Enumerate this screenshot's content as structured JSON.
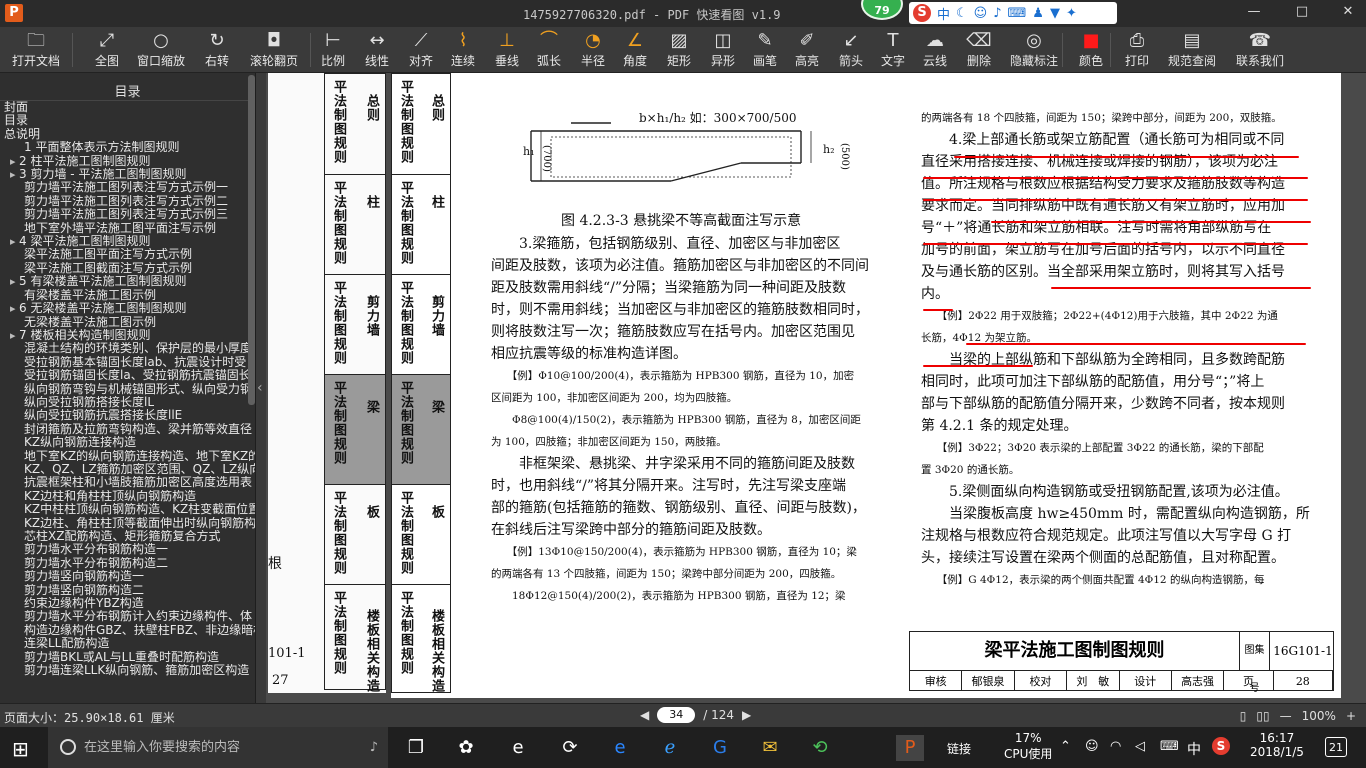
{
  "window": {
    "title": "1475927706320.pdf - PDF 快速看图 v1.9",
    "logo": "P",
    "notif_badge": "79",
    "ime_icons": [
      "sogou-s-icon",
      "中",
      "moon-icon",
      "smile-icon",
      "mic-icon",
      "keyboard-icon",
      "person-icon",
      "shirt-icon",
      "wrench-icon"
    ],
    "controls": [
      "—",
      "□",
      "✕"
    ]
  },
  "toolbar": {
    "items": [
      {
        "label": "打开文档",
        "icon": "folder-icon",
        "glyph": "🗀"
      },
      {
        "label": "全图",
        "icon": "fit-icon",
        "glyph": "⤢"
      },
      {
        "label": "窗口缩放",
        "icon": "zoom-icon",
        "glyph": "○"
      },
      {
        "label": "右转",
        "icon": "rotate-icon",
        "glyph": "↻"
      },
      {
        "label": "滚轮翻页",
        "icon": "mouse-icon",
        "glyph": "◘"
      },
      {
        "label": "比例",
        "icon": "scale-icon",
        "glyph": "⊢"
      },
      {
        "label": "线性",
        "icon": "linear-icon",
        "glyph": "↔"
      },
      {
        "label": "对齐",
        "icon": "align-icon",
        "glyph": "⟋"
      },
      {
        "label": "连续",
        "icon": "continuous-icon",
        "glyph": "⌇"
      },
      {
        "label": "垂线",
        "icon": "perpendicular-icon",
        "glyph": "⊥"
      },
      {
        "label": "弧长",
        "icon": "arc-icon",
        "glyph": "⌒"
      },
      {
        "label": "半径",
        "icon": "radius-icon",
        "glyph": "◔"
      },
      {
        "label": "角度",
        "icon": "angle-icon",
        "glyph": "∠"
      },
      {
        "label": "矩形",
        "icon": "rect-icon",
        "glyph": "▨"
      },
      {
        "label": "异形",
        "icon": "shape-icon",
        "glyph": "◫"
      },
      {
        "label": "画笔",
        "icon": "pen-icon",
        "glyph": "✎"
      },
      {
        "label": "高亮",
        "icon": "highlight-icon",
        "glyph": "✐"
      },
      {
        "label": "箭头",
        "icon": "arrow-icon",
        "glyph": "↙"
      },
      {
        "label": "文字",
        "icon": "text-icon",
        "glyph": "T"
      },
      {
        "label": "云线",
        "icon": "cloud-icon",
        "glyph": "☁"
      },
      {
        "label": "删除",
        "icon": "eraser-icon",
        "glyph": "⌫"
      },
      {
        "label": "隐藏标注",
        "icon": "eye-off-icon",
        "glyph": "◎"
      },
      {
        "label": "颜色",
        "icon": "color-icon",
        "glyph": "■"
      },
      {
        "label": "打印",
        "icon": "print-icon",
        "glyph": "⎙"
      },
      {
        "label": "规范查阅",
        "icon": "book-icon",
        "glyph": "▤"
      },
      {
        "label": "联系我们",
        "icon": "contact-icon",
        "glyph": "☎"
      }
    ]
  },
  "sidebar": {
    "header": "目录",
    "items": [
      {
        "t": "封面",
        "lvl": "l0"
      },
      {
        "t": "目录",
        "lvl": "l0"
      },
      {
        "t": "总说明",
        "lvl": "l0"
      },
      {
        "t": "1  平面整体表示方法制图规则",
        "lvl": "l1"
      },
      {
        "t": "2  柱平法施工图制图规则",
        "lvl": "exp"
      },
      {
        "t": "3  剪力墙 - 平法施工图制图规则",
        "lvl": "exp"
      },
      {
        "t": "剪力墙平法施工图列表注写方式示例一",
        "lvl": "l2"
      },
      {
        "t": "剪力墙平法施工图列表注写方式示例二",
        "lvl": "l2"
      },
      {
        "t": "剪力墙平法施工图列表注写方式示例三",
        "lvl": "l2"
      },
      {
        "t": "地下室外墙平法施工图平面注写示例",
        "lvl": "l2"
      },
      {
        "t": "4  梁平法施工图制图规则",
        "lvl": "exp"
      },
      {
        "t": "梁平法施工图平面注写方式示例",
        "lvl": "l2"
      },
      {
        "t": "梁平法施工图截面注写方式示例",
        "lvl": "l2"
      },
      {
        "t": "5  有梁楼盖平法施工图制图规则",
        "lvl": "exp"
      },
      {
        "t": "有梁楼盖平法施工图示例",
        "lvl": "l2"
      },
      {
        "t": "6  无梁楼盖平法施工图制图规则",
        "lvl": "exp"
      },
      {
        "t": "无梁楼盖平法施工图示例",
        "lvl": "l2"
      },
      {
        "t": "7  楼板相关构造制图规则",
        "lvl": "exp"
      },
      {
        "t": "混凝土结构的环境类别、保护层的最小厚度",
        "lvl": "l2"
      },
      {
        "t": "受拉钢筋基本锚固长度lab、抗震设计时受",
        "lvl": "l2"
      },
      {
        "t": "受拉钢筋锚固长度la、受拉钢筋抗震锚固长",
        "lvl": "l2"
      },
      {
        "t": "纵向钢筋弯钩与机械锚固形式、纵向受力钢",
        "lvl": "l2"
      },
      {
        "t": "纵向受拉钢筋搭接长度lL",
        "lvl": "l2"
      },
      {
        "t": "纵向受拉钢筋抗震搭接长度llE",
        "lvl": "l2"
      },
      {
        "t": "封闭箍筋及拉筋弯钩构造、梁并筋等效直径",
        "lvl": "l2"
      },
      {
        "t": "KZ纵向钢筋连接构造",
        "lvl": "l2"
      },
      {
        "t": "地下室KZ的纵向钢筋连接构造、地下室KZ的",
        "lvl": "l2"
      },
      {
        "t": "KZ、QZ、LZ箍筋加密区范围、QZ、LZ纵向钢",
        "lvl": "l2"
      },
      {
        "t": "抗震框架柱和小墙肢箍筋加密区高度选用表",
        "lvl": "l2"
      },
      {
        "t": "KZ边柱和角柱柱顶纵向钢筋构造",
        "lvl": "l2"
      },
      {
        "t": "KZ中柱柱顶纵向钢筋构造、KZ柱变截面位置",
        "lvl": "l2"
      },
      {
        "t": "KZ边柱、角柱柱顶等截面伸出时纵向钢筋构",
        "lvl": "l2"
      },
      {
        "t": "芯柱XZ配筋构造、矩形箍筋复合方式",
        "lvl": "l2"
      },
      {
        "t": "剪力墙水平分布钢筋构造一",
        "lvl": "l2"
      },
      {
        "t": "剪力墙水平分布钢筋构造二",
        "lvl": "l2"
      },
      {
        "t": "剪力墙竖向钢筋构造一",
        "lvl": "l2"
      },
      {
        "t": "剪力墙竖向钢筋构造二",
        "lvl": "l2"
      },
      {
        "t": "约束边缘构件YBZ构造",
        "lvl": "l2"
      },
      {
        "t": "剪力墙水平分布钢筋计入约束边缘构件、体",
        "lvl": "l2"
      },
      {
        "t": "构造边缘构件GBZ、扶壁柱FBZ、非边缘暗柱",
        "lvl": "l2"
      },
      {
        "t": "连梁LL配筋构造",
        "lvl": "l2"
      },
      {
        "t": "剪力墙BKL或AL与LL重叠时配筋构造",
        "lvl": "l2"
      },
      {
        "t": "剪力墙连梁LLK纵向钢筋、箍筋加密区构造",
        "lvl": "l2"
      }
    ]
  },
  "doc": {
    "left_page": {
      "col1": [
        "总则",
        "柱",
        "剪力墙",
        "梁",
        "板",
        "楼板相关构造"
      ],
      "col2": [
        "平法制图规则",
        "平法制图规则",
        "平法制图规则",
        "平法制图规则",
        "平法制图规则",
        "平法制图规则"
      ],
      "foot_code": "101-1",
      "foot_num": "27",
      "side_char": "根"
    },
    "nav_tab": {
      "col_a": [
        "总则",
        "柱",
        "剪力墙",
        "梁",
        "板",
        "楼板相关构造"
      ],
      "col_b": [
        "平法制图规则",
        "平法制图规则",
        "平法制图规则",
        "平法制图规则",
        "平法制图规则",
        "平法制图规则"
      ]
    },
    "figure": {
      "label_top": "b×h₁/h₂ 如：300×700/500",
      "h1": "h₁",
      "h1v": "(700)",
      "h2": "h₂",
      "h2v": "(500)",
      "caption": "图 4.2.3-3  悬挑梁不等高截面注写示意"
    },
    "left_col": [
      {
        "cls": "para",
        "t": "　　3.梁箍筋，包括钢筋级别、直径、加密区与非加密区"
      },
      {
        "cls": "para",
        "t": "间距及肢数，该项为必注值。箍筋加密区与非加密区的不同间"
      },
      {
        "cls": "para",
        "t": "距及肢数需用斜线“/”分隔；当梁箍筋为同一种间距及肢数"
      },
      {
        "cls": "para",
        "t": "时，则不需用斜线；当加密区与非加密区的箍筋肢数相同时，"
      },
      {
        "cls": "para",
        "t": "则将肢数注写一次；箍筋肢数应写在括号内。加密区范围见"
      },
      {
        "cls": "para",
        "t": "相应抗震等级的标准构造详图。"
      },
      {
        "cls": "small",
        "t": "　　【例】Φ10@100/200(4)，表示箍筋为 HPB300 钢筋，直径为 10，加密"
      },
      {
        "cls": "small",
        "t": "区间距为 100，非加密区间距为 200，均为四肢箍。"
      },
      {
        "cls": "small",
        "t": "　　Φ8@100(4)/150(2)，表示箍筋为 HPB300 钢筋，直径为 8，加密区间距"
      },
      {
        "cls": "small",
        "t": "为 100，四肢箍；非加密区间距为 150，两肢箍。"
      },
      {
        "cls": "para",
        "t": "　　非框架梁、悬挑梁、井字梁采用不同的箍筋间距及肢数"
      },
      {
        "cls": "para",
        "t": "时，也用斜线“/”将其分隔开来。注写时，先注写梁支座端"
      },
      {
        "cls": "para",
        "t": "部的箍筋(包括箍筋的箍数、钢筋级别、直径、间距与肢数)，"
      },
      {
        "cls": "para",
        "t": "在斜线后注写梁跨中部分的箍筋间距及肢数。"
      },
      {
        "cls": "small",
        "t": "　　【例】13Φ10@150/200(4)，表示箍筋为 HPB300 钢筋，直径为 10；梁"
      },
      {
        "cls": "small",
        "t": "的两端各有 13 个四肢箍，间距为 150；梁跨中部分间距为 200，四肢箍。"
      },
      {
        "cls": "small",
        "t": "　　18Φ12@150(4)/200(2)，表示箍筋为 HPB300 钢筋，直径为 12；梁"
      }
    ],
    "right_col": [
      {
        "cls": "small",
        "t": "的两端各有 18 个四肢箍，间距为 150；梁跨中部分，间距为 200，双肢箍。"
      },
      {
        "cls": "para",
        "t": "　　4.梁上部通长筋或架立筋配置（通长筋可为相同或不同"
      },
      {
        "cls": "para",
        "t": "直径采用搭接连接、机械连接或焊接的钢筋），该项为必注"
      },
      {
        "cls": "para",
        "t": "值。所注规格与根数应根据结构受力要求及箍筋肢数等构造"
      },
      {
        "cls": "para",
        "t": "要求而定。当同排纵筋中既有通长筋又有架立筋时，应用加"
      },
      {
        "cls": "para",
        "t": "号“＋”将通长筋和架立筋相联。注写时需将角部纵筋写在"
      },
      {
        "cls": "para",
        "t": "加号的前面，架立筋写在加号后面的括号内，以示不同直径"
      },
      {
        "cls": "para",
        "t": "及与通长筋的区别。当全部采用架立筋时，则将其写入括号"
      },
      {
        "cls": "para",
        "t": "内。"
      },
      {
        "cls": "small",
        "t": "　　【例】2Φ22 用于双肢箍；2Φ22+(4Φ12)用于六肢箍，其中 2Φ22 为通"
      },
      {
        "cls": "small",
        "t": "长筋，4Φ12 为架立筋。"
      },
      {
        "cls": "para",
        "t": "　　当梁的上部纵筋和下部纵筋为全跨相同，且多数跨配筋"
      },
      {
        "cls": "para",
        "t": "相同时，此项可加注下部纵筋的配筋值，用分号“；”将上"
      },
      {
        "cls": "para",
        "t": "部与下部纵筋的配筋值分隔开来，少数跨不同者，按本规则"
      },
      {
        "cls": "para",
        "t": "第 4.2.1 条的规定处理。"
      },
      {
        "cls": "small",
        "t": "　　【例】3Φ22；3Φ20 表示梁的上部配置 3Φ22 的通长筋，梁的下部配"
      },
      {
        "cls": "small",
        "t": "置 3Φ20 的通长筋。"
      },
      {
        "cls": "para",
        "t": "　　5.梁侧面纵向构造钢筋或受扭钢筋配置,该项为必注值。"
      },
      {
        "cls": "para",
        "t": "　　当梁腹板高度 hw≥450mm 时，需配置纵向构造钢筋，所"
      },
      {
        "cls": "para",
        "t": "注规格与根数应符合规范规定。此项注写值以大写字母 G 打"
      },
      {
        "cls": "para",
        "t": "头，接续注写设置在梁两个侧面的总配筋值，且对称配置。"
      },
      {
        "cls": "small",
        "t": "　　【例】G 4Φ12，表示梁的两个侧面共配置 4Φ12 的纵向构造钢筋，每"
      }
    ],
    "titleblock": {
      "title": "梁平法施工图制图规则",
      "atlas_label": "图集号",
      "atlas_no": "16G101-1",
      "row2": [
        "审核",
        "郁银泉",
        "校对",
        "刘　敏",
        "设计",
        "高志强",
        "页",
        "28"
      ]
    }
  },
  "status": {
    "page_size": "页面大小：25.90×18.61 厘米",
    "current_page": "34",
    "total_pages": "/ 124",
    "zoom": "100%"
  },
  "taskbar": {
    "search_placeholder": "在这里输入你要搜索的内容",
    "link_label": "链接",
    "cpu_pct": "17%",
    "cpu_label": "CPU使用",
    "ime": "中",
    "time": "16:17",
    "date": "2018/1/5",
    "notif_count": "21"
  }
}
